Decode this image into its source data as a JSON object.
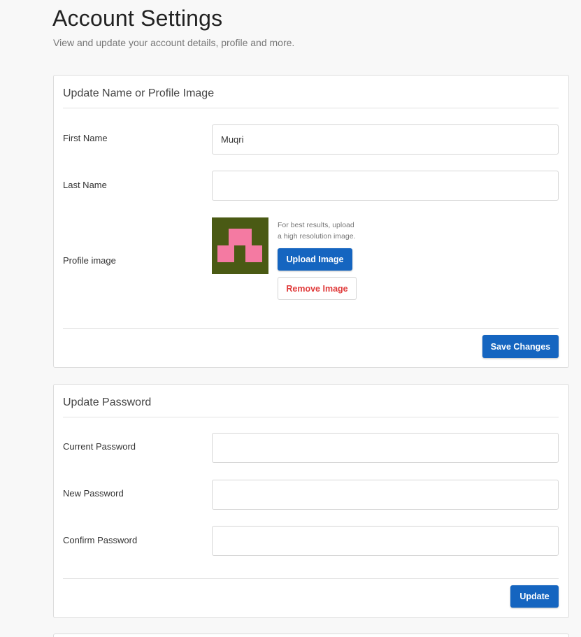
{
  "page": {
    "title": "Account Settings",
    "subtitle": "View and update your account details, profile and more."
  },
  "profile_card": {
    "title": "Update Name or Profile Image",
    "first_name_label": "First Name",
    "first_name_value": "Muqri",
    "last_name_label": "Last Name",
    "last_name_value": "",
    "profile_image_label": "Profile image",
    "hint_line1": "For best results, upload",
    "hint_line2": "a high resolution image.",
    "upload_label": "Upload Image",
    "remove_label": "Remove Image",
    "save_label": "Save Changes"
  },
  "password_card": {
    "title": "Update Password",
    "current_label": "Current Password",
    "new_label": "New Password",
    "confirm_label": "Confirm Password",
    "update_label": "Update"
  },
  "colors": {
    "primary": "#1565c0",
    "danger": "#e03b3b",
    "avatar_bg": "#4a5a14",
    "avatar_fg": "#f47aa2"
  }
}
